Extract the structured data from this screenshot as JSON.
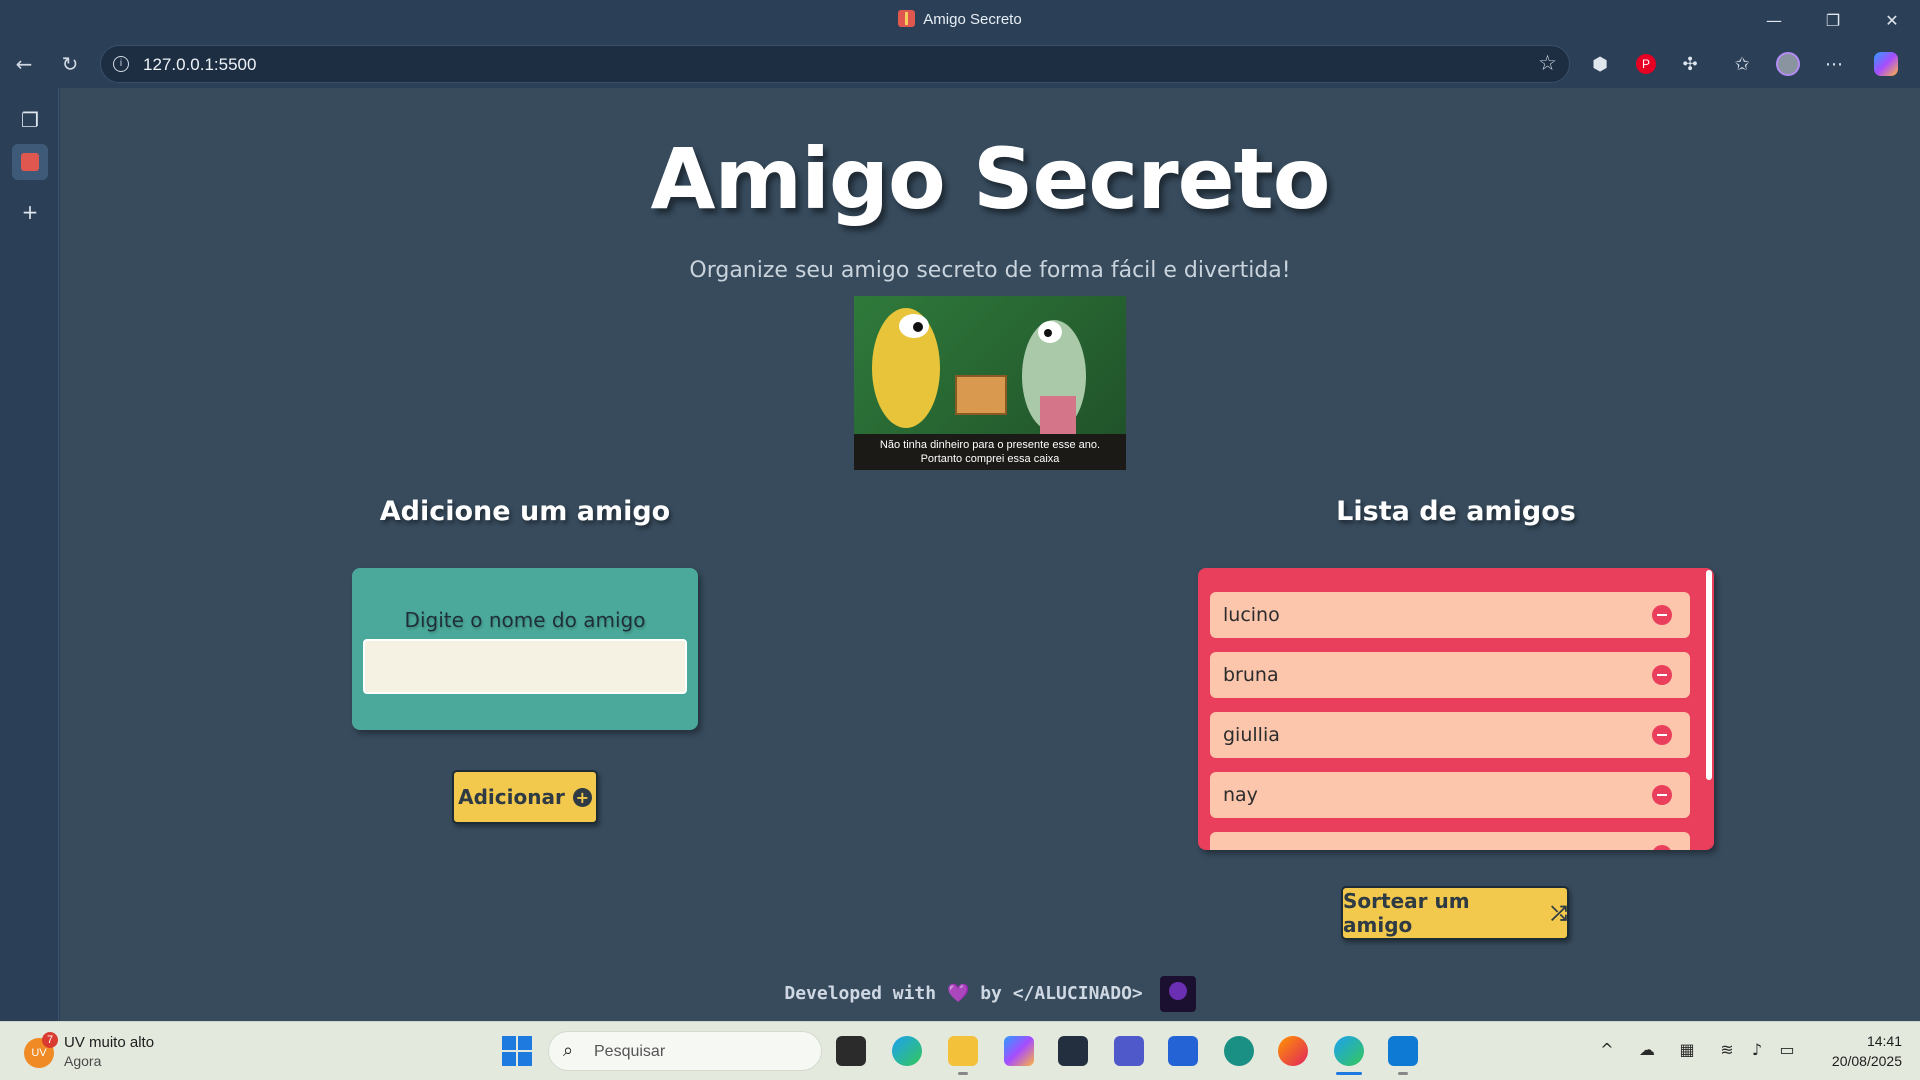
{
  "browser": {
    "tab_title": "Amigo Secreto",
    "url": "127.0.0.1:5500"
  },
  "page": {
    "title": "Amigo Secreto",
    "subtitle": "Organize seu amigo secreto de forma fácil e divertida!",
    "meme_caption_line1": "Não tinha dinheiro para o presente esse ano.",
    "meme_caption_line2": "Portanto comprei essa caixa",
    "add_section_title": "Adicione um amigo",
    "input_label": "Digite o nome do amigo",
    "input_value": "",
    "add_button": "Adicionar",
    "list_section_title": "Lista de amigos",
    "friends": [
      "lucino",
      "bruna",
      "giullia",
      "nay"
    ],
    "draw_button": "Sortear um amigo",
    "footer_prefix": "Developed with",
    "footer_heart": "💜",
    "footer_suffix": "by </ALUCINADO>"
  },
  "taskbar": {
    "weather_title": "UV muito alto",
    "weather_sub": "Agora",
    "weather_badge": "7",
    "weather_icon_text": "UV",
    "search_placeholder": "Pesquisar",
    "time": "14:41",
    "date": "20/08/2025"
  },
  "colors": {
    "page_bg": "#374b5d",
    "add_card": "#4aa99a",
    "list_card": "#ea3f5c",
    "list_item": "#fcc6ac",
    "button": "#f2c94c"
  }
}
